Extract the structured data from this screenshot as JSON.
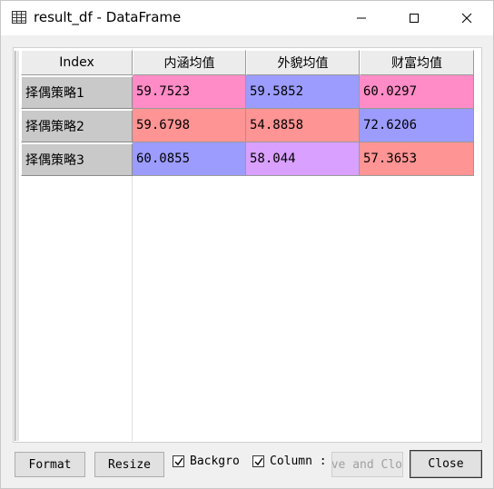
{
  "window": {
    "title": "result_df - DataFrame"
  },
  "icons": {
    "app": "table-icon",
    "minimize": "minimize-icon",
    "maximize": "maximize-icon",
    "close": "close-icon"
  },
  "table": {
    "index_header": "Index",
    "columns": [
      "内涵均值",
      "外貌均值",
      "财富均值"
    ],
    "rows": [
      {
        "index": "择偶策略1",
        "values": [
          "59.7523",
          "59.5852",
          "60.0297"
        ]
      },
      {
        "index": "择偶策略2",
        "values": [
          "59.6798",
          "54.8858",
          "72.6206"
        ]
      },
      {
        "index": "择偶策略3",
        "values": [
          "60.0855",
          "58.044",
          "57.3653"
        ]
      }
    ],
    "cell_colors": [
      [
        "#ff8cc6",
        "#9c9cff",
        "#ff8cc6"
      ],
      [
        "#ff9494",
        "#ff9494",
        "#9c9cff"
      ],
      [
        "#9c9cff",
        "#d9a0ff",
        "#ff9494"
      ]
    ]
  },
  "buttons": {
    "format": "Format",
    "resize": "Resize",
    "save_and_close": "ve and Clo",
    "close": "Close"
  },
  "checkboxes": {
    "background": {
      "label": "Backgro",
      "checked": true
    },
    "column": {
      "label": "Column :",
      "checked": true
    }
  }
}
